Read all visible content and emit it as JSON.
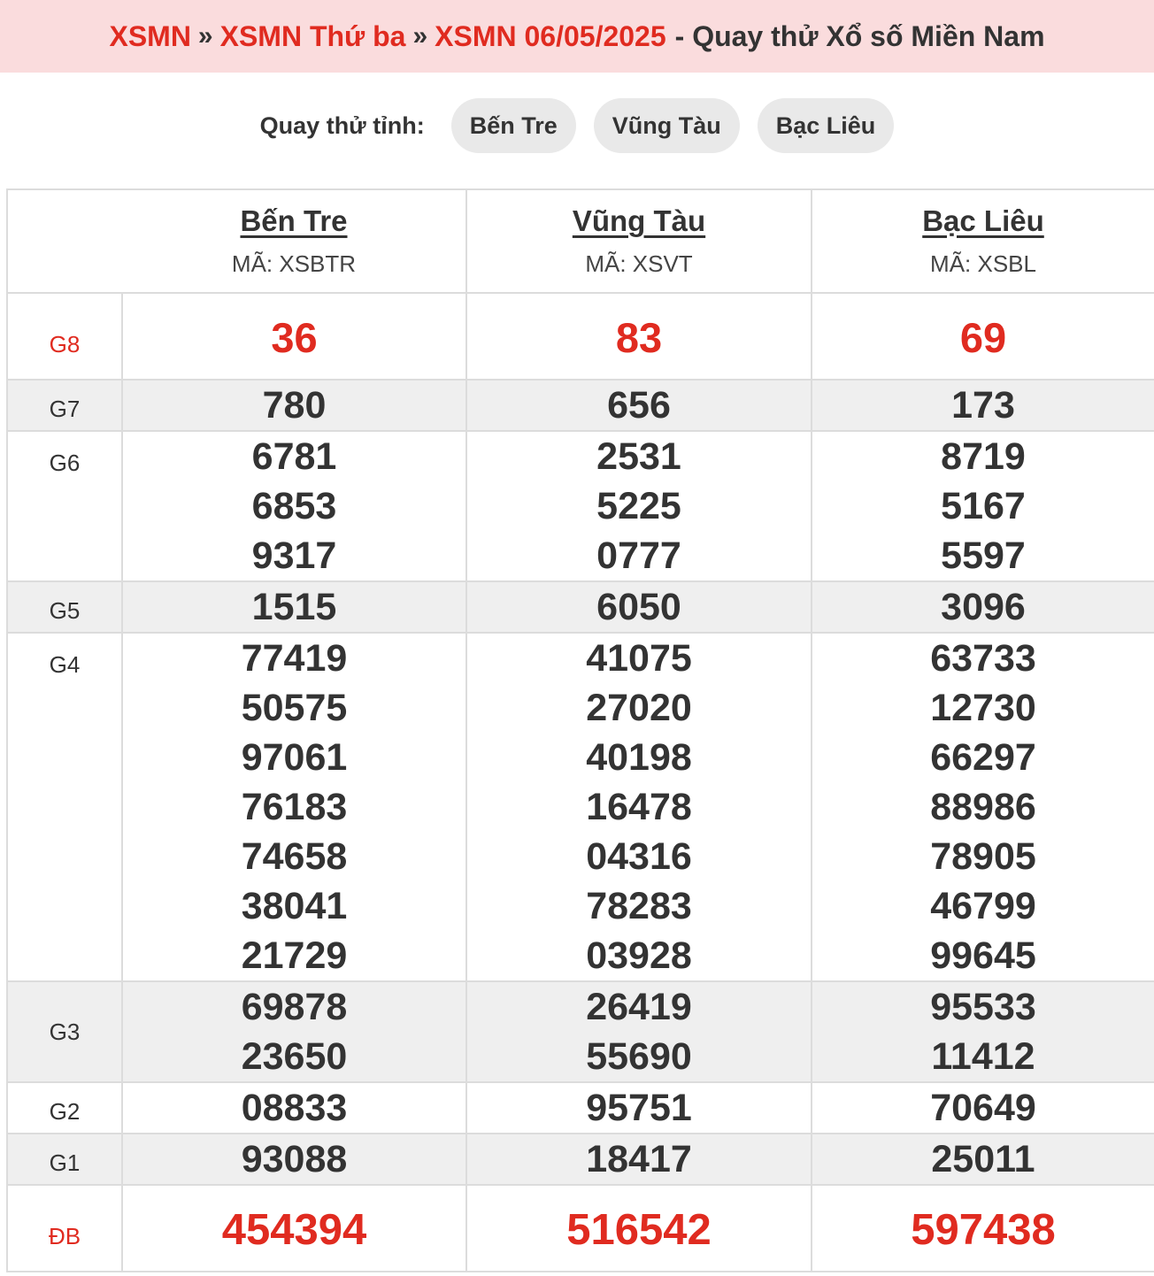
{
  "breadcrumb": {
    "items": [
      "XSMN",
      "XSMN Thứ ba",
      "XSMN 06/05/2025"
    ],
    "separator": "»",
    "tail": "- Quay thử Xổ số Miền Nam"
  },
  "pick": {
    "label": "Quay thử tỉnh:",
    "buttons": [
      "Bến Tre",
      "Vũng Tàu",
      "Bạc Liêu"
    ]
  },
  "provinces": [
    {
      "name": "Bến Tre",
      "code": "MÃ: XSBTR"
    },
    {
      "name": "Vũng Tàu",
      "code": "MÃ: XSVT"
    },
    {
      "name": "Bạc Liêu",
      "code": "MÃ: XSBL"
    }
  ],
  "prizes": {
    "g8": {
      "label": "G8",
      "values": [
        [
          "36"
        ],
        [
          "83"
        ],
        [
          "69"
        ]
      ]
    },
    "g7": {
      "label": "G7",
      "values": [
        [
          "780"
        ],
        [
          "656"
        ],
        [
          "173"
        ]
      ]
    },
    "g6": {
      "label": "G6",
      "values": [
        [
          "6781",
          "6853",
          "9317"
        ],
        [
          "2531",
          "5225",
          "0777"
        ],
        [
          "8719",
          "5167",
          "5597"
        ]
      ]
    },
    "g5": {
      "label": "G5",
      "values": [
        [
          "1515"
        ],
        [
          "6050"
        ],
        [
          "3096"
        ]
      ]
    },
    "g4": {
      "label": "G4",
      "values": [
        [
          "77419",
          "50575",
          "97061",
          "76183",
          "74658",
          "38041",
          "21729"
        ],
        [
          "41075",
          "27020",
          "40198",
          "16478",
          "04316",
          "78283",
          "03928"
        ],
        [
          "63733",
          "12730",
          "66297",
          "88986",
          "78905",
          "46799",
          "99645"
        ]
      ]
    },
    "g3": {
      "label": "G3",
      "values": [
        [
          "69878",
          "23650"
        ],
        [
          "26419",
          "55690"
        ],
        [
          "95533",
          "11412"
        ]
      ]
    },
    "g2": {
      "label": "G2",
      "values": [
        [
          "08833"
        ],
        [
          "95751"
        ],
        [
          "70649"
        ]
      ]
    },
    "g1": {
      "label": "G1",
      "values": [
        [
          "93088"
        ],
        [
          "18417"
        ],
        [
          "25011"
        ]
      ]
    },
    "db": {
      "label": "ĐB",
      "values": [
        [
          "454394"
        ],
        [
          "516542"
        ],
        [
          "597438"
        ]
      ]
    }
  },
  "colors": {
    "accent": "#e02b20",
    "header_bg": "#fadcdd",
    "row_alt": "#efefef",
    "pill_bg": "#e9e9e9"
  }
}
